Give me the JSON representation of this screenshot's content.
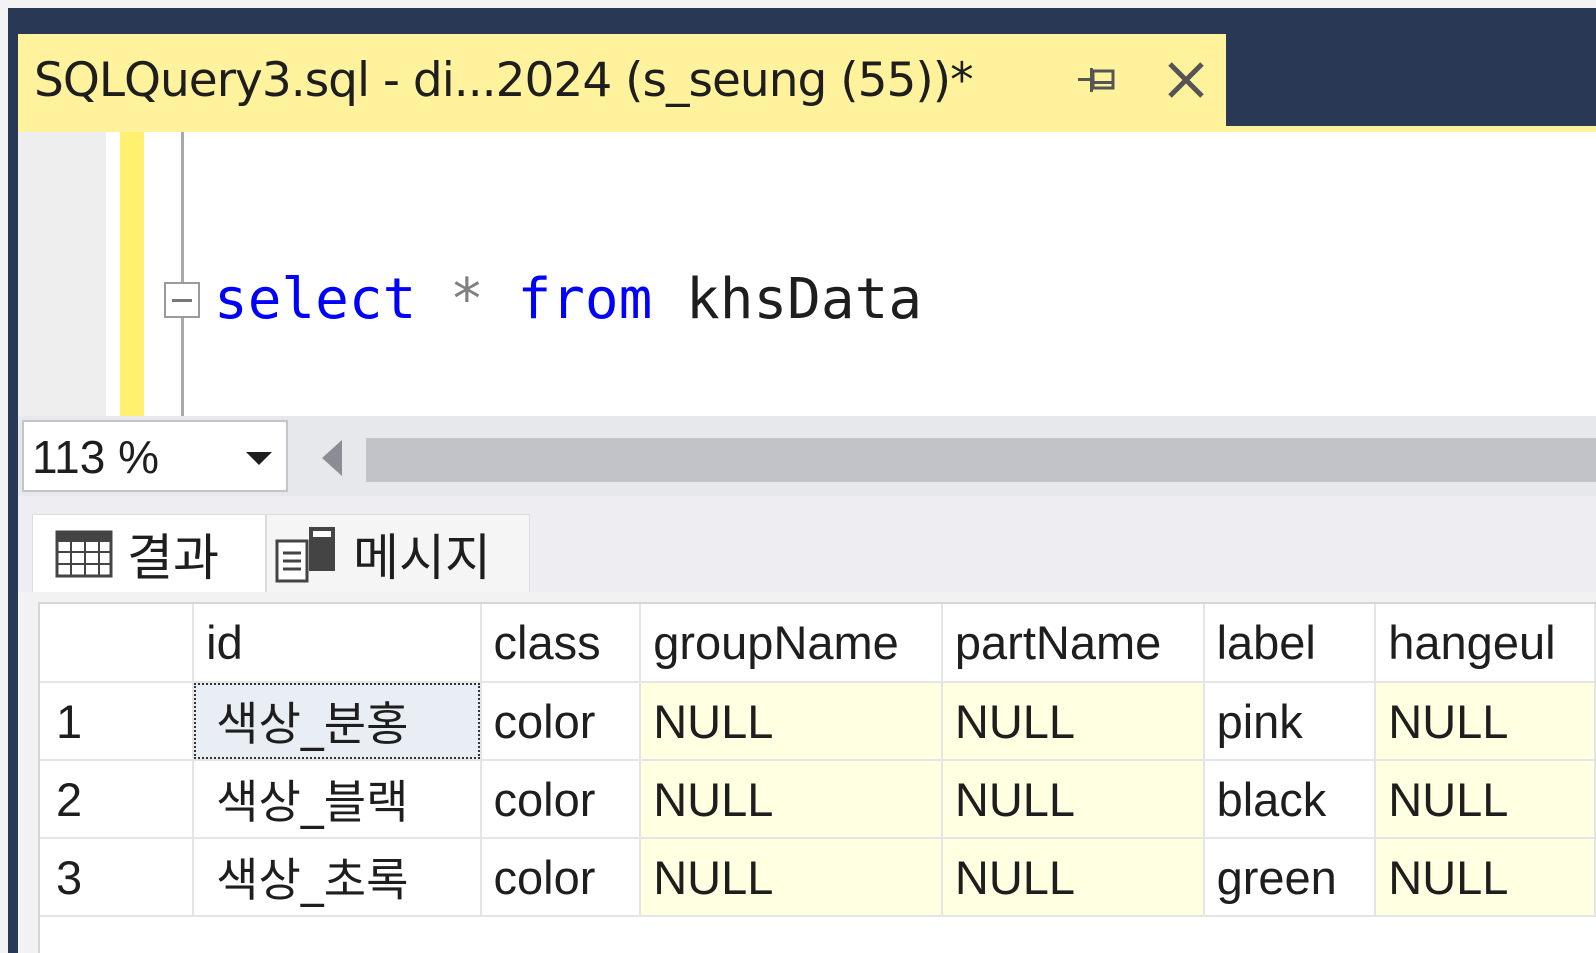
{
  "tab": {
    "title": "SQLQuery3.sql - di...2024 (s_seung (55))*"
  },
  "editor": {
    "tokens": {
      "select": "select",
      "star": "*",
      "from": "from",
      "table": "khsData"
    }
  },
  "zoom": {
    "level": "113 %"
  },
  "result_tabs": [
    {
      "label": "결과",
      "icon": "grid-icon",
      "active": true
    },
    {
      "label": "메시지",
      "icon": "messages-icon",
      "active": false
    }
  ],
  "grid": {
    "columns": [
      "",
      "id",
      "class",
      "groupName",
      "partName",
      "label",
      "hangeul"
    ],
    "rows": [
      [
        "1",
        "색상_분홍",
        "color",
        "NULL",
        "NULL",
        "pink",
        "NULL"
      ],
      [
        "2",
        "색상_블랙",
        "color",
        "NULL",
        "NULL",
        "black",
        "NULL"
      ],
      [
        "3",
        "색상_초록",
        "color",
        "NULL",
        "NULL",
        "green",
        "NULL"
      ]
    ]
  },
  "colors": {
    "tab_active": "#fff29d",
    "keyword": "#0000ff",
    "null_cell": "#ffffe1",
    "chrome": "#293955"
  }
}
